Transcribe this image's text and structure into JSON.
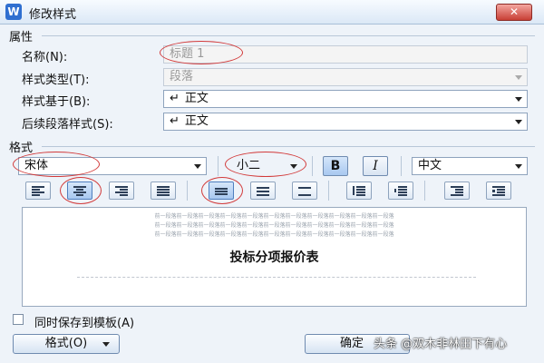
{
  "window": {
    "title": "修改样式",
    "app_icon": "W",
    "close_glyph": "✕"
  },
  "properties": {
    "section_label": "属性",
    "name_label": "名称(N):",
    "name_value": "标题 1",
    "style_type_label": "样式类型(T):",
    "style_type_value": "段落",
    "based_on_label": "样式基于(B):",
    "based_on_value": "正文",
    "next_style_label": "后续段落样式(S):",
    "next_style_value": "正文",
    "paragraph_mark_glyph": "↵"
  },
  "format": {
    "section_label": "格式",
    "font": "宋体",
    "size": "小二",
    "bold_label": "B",
    "italic_label": "I",
    "language": "中文"
  },
  "preview": {
    "sample_line": "前一段落前一段落前一段落前一段落前一段落前一段落前一段落前一段落前一段落前一段落前一段落",
    "heading": "投标分项报价表"
  },
  "footer": {
    "save_to_template_label": "同时保存到模板(A)",
    "format_button": "格式(O)",
    "ok_button": "确定",
    "watermark": "头条 @双木非林田下有心"
  },
  "colors": {
    "accent": "#2f6fd0",
    "annotation": "#d23a3a",
    "close": "#c83f35"
  }
}
